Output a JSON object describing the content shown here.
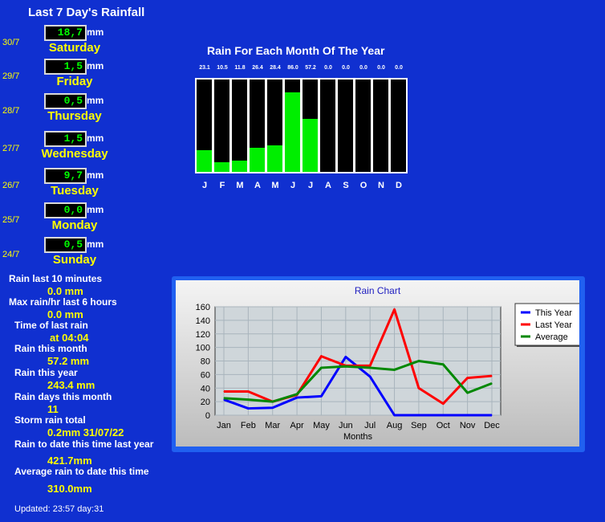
{
  "page": {
    "title": "Last 7 Day's Rainfall",
    "updated": "Updated: 23:57 day:31"
  },
  "days": [
    {
      "date": "30/7",
      "value": "18,7",
      "unit": "mm",
      "day": "Saturday"
    },
    {
      "date": "29/7",
      "value": "1,5",
      "unit": "mm",
      "day": "Friday"
    },
    {
      "date": "28/7",
      "value": "0,5",
      "unit": "mm",
      "day": "Thursday"
    },
    {
      "date": "27/7",
      "value": "1,5",
      "unit": "mm",
      "day": "Wednesday"
    },
    {
      "date": "26/7",
      "value": "9,7",
      "unit": "mm",
      "day": "Tuesday"
    },
    {
      "date": "25/7",
      "value": "0,0",
      "unit": "mm",
      "day": "Monday"
    },
    {
      "date": "24/7",
      "value": "0,5",
      "unit": "mm",
      "day": "Sunday"
    }
  ],
  "stats": [
    {
      "label": "Rain last 10 minutes",
      "value": "0.0 mm"
    },
    {
      "label": "Max rain/hr last 6 hours",
      "value": "0.0 mm"
    },
    {
      "label": "Time of last rain",
      "value": "at 04:04"
    },
    {
      "label": "Rain this month",
      "value": "57.2 mm"
    },
    {
      "label": "Rain this year",
      "value": "243.4 mm"
    },
    {
      "label": "Rain days this month",
      "value": "11"
    },
    {
      "label": "Storm rain total",
      "value": "0.2mm 31/07/22"
    },
    {
      "label": "Rain to date this time last year",
      "value": "421.7mm"
    },
    {
      "label": "Average rain to date this time",
      "value": "310.0mm"
    }
  ],
  "chart_data": [
    {
      "type": "bar",
      "title": "Rain For Each Month Of The Year",
      "categories": [
        "J",
        "F",
        "M",
        "A",
        "M",
        "J",
        "J",
        "A",
        "S",
        "O",
        "N",
        "D"
      ],
      "values": [
        23.1,
        10.5,
        11.8,
        26.4,
        28.4,
        86.0,
        57.2,
        0.0,
        0.0,
        0.0,
        0.0,
        0.0
      ],
      "value_labels": [
        "23.1",
        "10.5",
        "11.8",
        "26.4",
        "28.4",
        "86.0",
        "57.2",
        "0.0",
        "0.0",
        "0.0",
        "0.0",
        "0.0"
      ],
      "ylim": [
        0,
        100
      ],
      "bar_color": "#00ee00"
    },
    {
      "type": "line",
      "title": "Rain Chart",
      "xlabel": "Months",
      "ylabel": "",
      "categories": [
        "Jan",
        "Feb",
        "Mar",
        "Apr",
        "May",
        "Jun",
        "Jul",
        "Aug",
        "Sep",
        "Oct",
        "Nov",
        "Dec"
      ],
      "yticks": [
        0,
        20,
        40,
        60,
        80,
        100,
        120,
        140,
        160
      ],
      "ylim": [
        0,
        160
      ],
      "grid": true,
      "legend_position": "top-right",
      "series": [
        {
          "name": "This Year",
          "color": "#0000ff",
          "values": [
            23,
            10,
            11,
            26,
            28,
            86,
            57,
            0,
            0,
            0,
            0,
            0
          ]
        },
        {
          "name": "Last Year",
          "color": "#ff0000",
          "values": [
            35,
            35,
            20,
            30,
            87,
            73,
            73,
            156,
            40,
            17,
            55,
            58
          ]
        },
        {
          "name": "Average",
          "color": "#008800",
          "values": [
            25,
            23,
            20,
            31,
            70,
            72,
            70,
            67,
            80,
            75,
            33,
            47
          ]
        }
      ]
    }
  ]
}
